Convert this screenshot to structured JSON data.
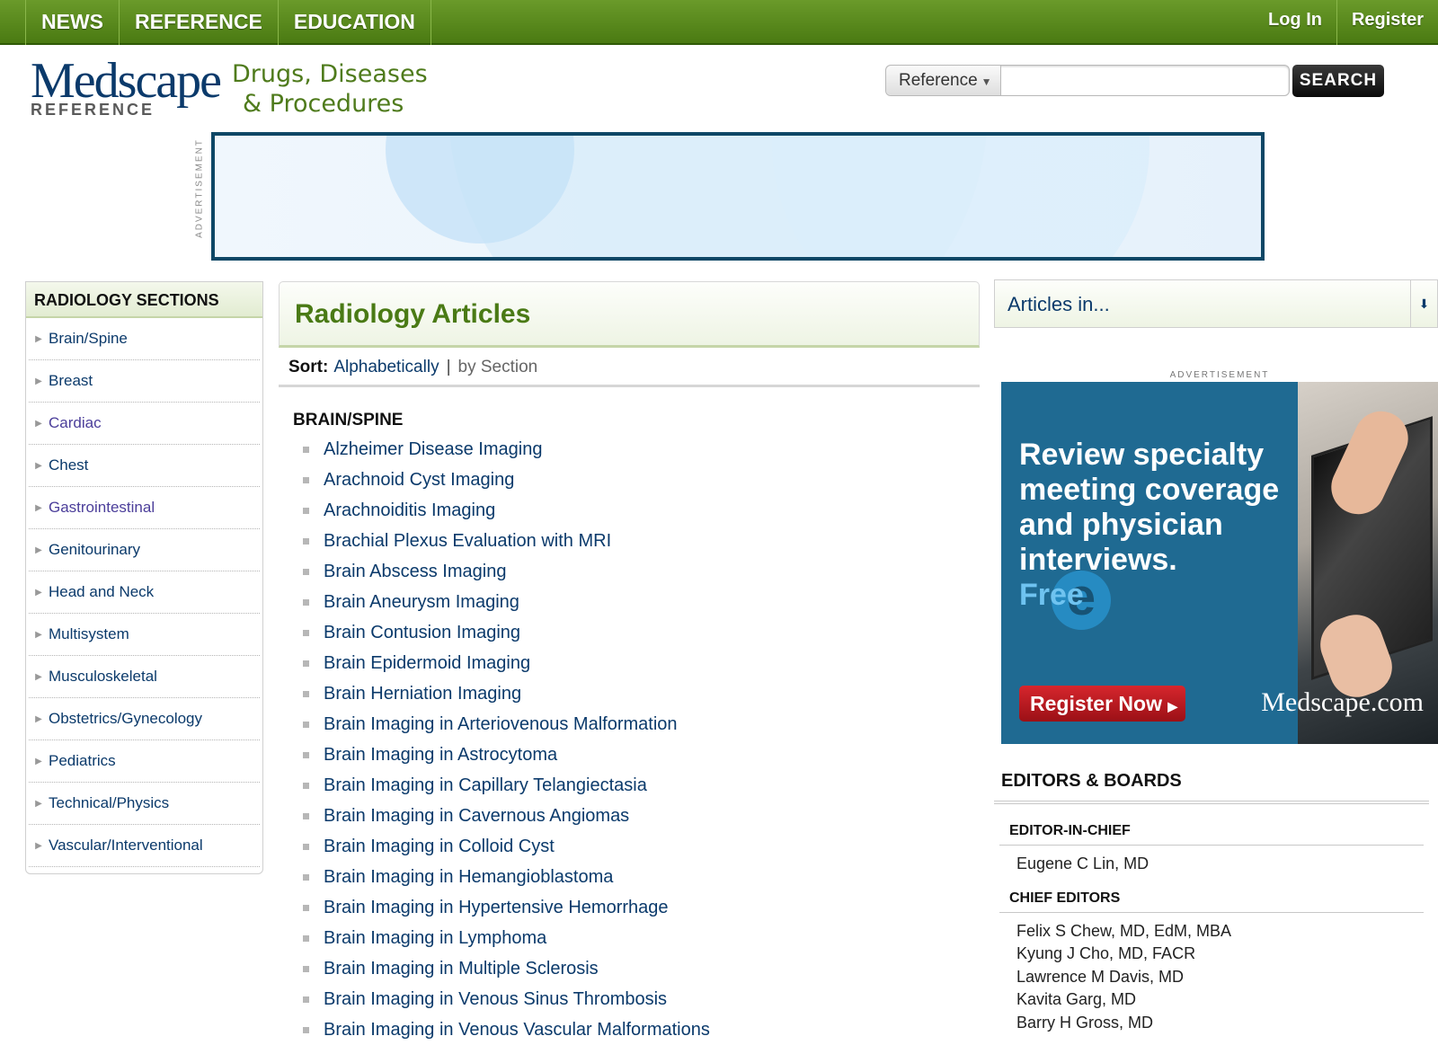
{
  "topnav": {
    "tabs": [
      "NEWS",
      "REFERENCE",
      "EDUCATION"
    ],
    "login": "Log In",
    "register": "Register"
  },
  "logo": {
    "word": "Medscape",
    "sub": "REFERENCE",
    "tagline_line1": "Drugs, Diseases",
    "tagline_line2": "& Procedures"
  },
  "search": {
    "scope": "Reference",
    "placeholder": "",
    "button": "SEARCH"
  },
  "ad_label": "ADVERTISEMENT",
  "sidebar": {
    "title": "RADIOLOGY SECTIONS",
    "items": [
      {
        "label": "Brain/Spine"
      },
      {
        "label": "Breast"
      },
      {
        "label": "Cardiac"
      },
      {
        "label": "Chest"
      },
      {
        "label": "Gastrointestinal"
      },
      {
        "label": "Genitourinary"
      },
      {
        "label": "Head and Neck"
      },
      {
        "label": "Multisystem"
      },
      {
        "label": "Musculoskeletal"
      },
      {
        "label": "Obstetrics/Gynecology"
      },
      {
        "label": "Pediatrics"
      },
      {
        "label": "Technical/Physics"
      },
      {
        "label": "Vascular/Interventional"
      }
    ]
  },
  "main": {
    "title": "Radiology Articles",
    "sort_label": "Sort:",
    "sort_alpha": "Alphabetically",
    "sort_sep": "|",
    "sort_section": "by Section",
    "section_title": "BRAIN/SPINE",
    "articles": [
      "Alzheimer Disease Imaging",
      "Arachnoid Cyst Imaging",
      "Arachnoiditis Imaging",
      "Brachial Plexus Evaluation with MRI",
      "Brain Abscess Imaging",
      "Brain Aneurysm Imaging",
      "Brain Contusion Imaging",
      "Brain Epidermoid Imaging",
      "Brain Herniation Imaging",
      "Brain Imaging in Arteriovenous Malformation",
      "Brain Imaging in Astrocytoma",
      "Brain Imaging in Capillary Telangiectasia",
      "Brain Imaging in Cavernous Angiomas",
      "Brain Imaging in Colloid Cyst",
      "Brain Imaging in Hemangioblastoma",
      "Brain Imaging in Hypertensive Hemorrhage",
      "Brain Imaging in Lymphoma",
      "Brain Imaging in Multiple Sclerosis",
      "Brain Imaging in Venous Sinus Thrombosis",
      "Brain Imaging in Venous Vascular Malformations"
    ]
  },
  "right": {
    "articles_in": "Articles in...",
    "ad": {
      "headline": "Review specialty meeting coverage and physician interviews.",
      "free": "Free",
      "button": "Register Now",
      "brand": "Medscape.com"
    },
    "editors": {
      "title": "EDITORS & BOARDS",
      "chief_label": "EDITOR-IN-CHIEF",
      "chief": "Eugene C Lin, MD",
      "chiefs_label": "CHIEF EDITORS",
      "chiefs": [
        "Felix S Chew, MD, EdM, MBA",
        "Kyung J Cho, MD, FACR",
        "Lawrence M Davis, MD",
        "Kavita Garg, MD",
        "Barry H Gross, MD"
      ]
    }
  }
}
